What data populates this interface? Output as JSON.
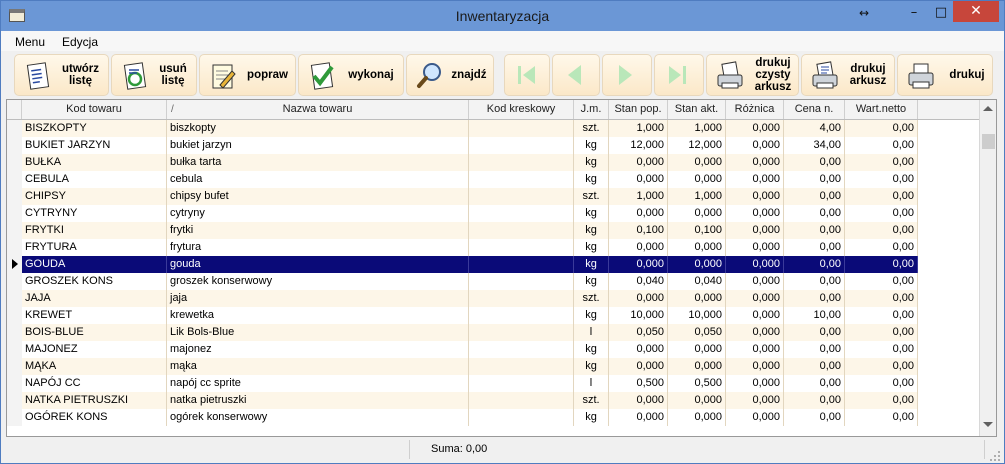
{
  "window": {
    "title": "Inwentaryzacja",
    "resize_glyph": "↔",
    "min_glyph": "–",
    "max_glyph": "□",
    "close_glyph": "✕"
  },
  "menu": [
    {
      "label": "Menu"
    },
    {
      "label": "Edycja"
    }
  ],
  "toolbar": {
    "create": "utwórz\nlistę",
    "delete": "usuń\nlistę",
    "edit": "popraw",
    "execute": "wykonaj",
    "find": "znajdź",
    "print_blank": "drukuj\nczysty\narkusz",
    "print_sheet": "drukuj\narkusz",
    "print": "drukuj"
  },
  "table": {
    "headers": [
      "Kod towaru",
      "/",
      "Nazwa towaru",
      "Kod kreskowy",
      "J.m.",
      "Stan pop.",
      "Stan akt.",
      "Różnica",
      "Cena n.",
      "Wart.netto"
    ],
    "rows": [
      [
        "BISZKOPTY",
        "biszkopty",
        "",
        "szt.",
        "1,000",
        "1,000",
        "0,000",
        "4,00",
        "0,00"
      ],
      [
        "BUKIET JARZYN",
        "bukiet jarzyn",
        "",
        "kg",
        "12,000",
        "12,000",
        "0,000",
        "34,00",
        "0,00"
      ],
      [
        "BUŁKA",
        "bułka tarta",
        "",
        "kg",
        "0,000",
        "0,000",
        "0,000",
        "0,00",
        "0,00"
      ],
      [
        "CEBULA",
        "cebula",
        "",
        "kg",
        "0,000",
        "0,000",
        "0,000",
        "0,00",
        "0,00"
      ],
      [
        "CHIPSY",
        "chipsy bufet",
        "",
        "szt.",
        "1,000",
        "1,000",
        "0,000",
        "0,00",
        "0,00"
      ],
      [
        "CYTRYNY",
        "cytryny",
        "",
        "kg",
        "0,000",
        "0,000",
        "0,000",
        "0,00",
        "0,00"
      ],
      [
        "FRYTKI",
        "frytki",
        "",
        "kg",
        "0,100",
        "0,100",
        "0,000",
        "0,00",
        "0,00"
      ],
      [
        "FRYTURA",
        "frytura",
        "",
        "kg",
        "0,000",
        "0,000",
        "0,000",
        "0,00",
        "0,00"
      ],
      [
        "GOUDA",
        "gouda",
        "",
        "kg",
        "0,000",
        "0,000",
        "0,000",
        "0,00",
        "0,00"
      ],
      [
        "GROSZEK KONS",
        "groszek konserwowy",
        "",
        "kg",
        "0,040",
        "0,040",
        "0,000",
        "0,00",
        "0,00"
      ],
      [
        "JAJA",
        "jaja",
        "",
        "szt.",
        "0,000",
        "0,000",
        "0,000",
        "0,00",
        "0,00"
      ],
      [
        "KREWET",
        "krewetka",
        "",
        "kg",
        "10,000",
        "10,000",
        "0,000",
        "10,00",
        "0,00"
      ],
      [
        "BOIS-BLUE",
        "Lik Bols-Blue",
        "",
        "l",
        "0,050",
        "0,050",
        "0,000",
        "0,00",
        "0,00"
      ],
      [
        "MAJONEZ",
        "majonez",
        "",
        "kg",
        "0,000",
        "0,000",
        "0,000",
        "0,00",
        "0,00"
      ],
      [
        "MĄKA",
        "mąka",
        "",
        "kg",
        "0,000",
        "0,000",
        "0,000",
        "0,00",
        "0,00"
      ],
      [
        "NAPÓJ CC",
        "napój cc sprite",
        "",
        "l",
        "0,500",
        "0,500",
        "0,000",
        "0,00",
        "0,00"
      ],
      [
        "NATKA PIETRUSZKI",
        "natka pietruszki",
        "",
        "szt.",
        "0,000",
        "0,000",
        "0,000",
        "0,00",
        "0,00"
      ],
      [
        "OGÓREK KONS",
        "ogórek konserwowy",
        "",
        "kg",
        "0,000",
        "0,000",
        "0,000",
        "0,00",
        "0,00"
      ]
    ],
    "selected_row": 8,
    "selected_color": "#0a0a78"
  },
  "status": {
    "sum_text": "Suma: 0,00"
  }
}
